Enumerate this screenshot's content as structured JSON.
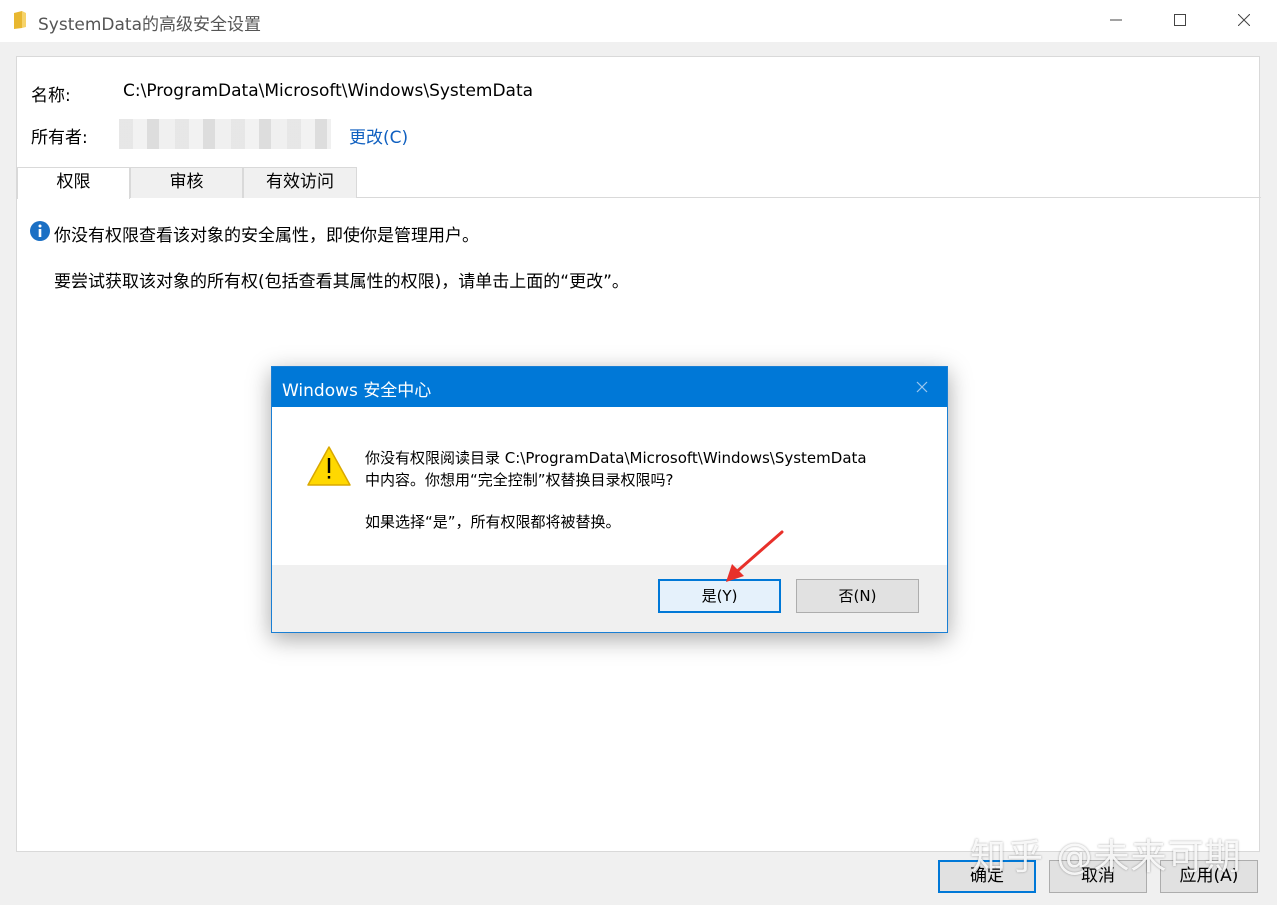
{
  "window": {
    "title": "SystemData的高级安全设置"
  },
  "panel": {
    "name_label": "名称:",
    "name_value": "C:\\ProgramData\\Microsoft\\Windows\\SystemData",
    "owner_label": "所有者:",
    "change_link": "更改(C)",
    "tabs": [
      {
        "label": "权限"
      },
      {
        "label": "审核"
      },
      {
        "label": "有效访问"
      }
    ],
    "info_text": "你没有权限查看该对象的安全属性，即使你是管理用户。",
    "hint_text": "要尝试获取该对象的所有权(包括查看其属性的权限)，请单击上面的“更改”。"
  },
  "buttons": {
    "ok": "确定",
    "cancel": "取消",
    "apply": "应用(A)"
  },
  "watermark": "知乎 @未来可期",
  "dialog": {
    "title": "Windows 安全中心",
    "line1": "你没有权限阅读目录 C:\\ProgramData\\Microsoft\\Windows\\SystemData",
    "line2": "中内容。你想用“完全控制”权替换目录权限吗?",
    "line3": "如果选择“是”，所有权限都将被替换。",
    "yes": "是(Y)",
    "no": "否(N)"
  },
  "colors": {
    "accent": "#0078d7",
    "link": "#1060c0",
    "warning": "#ffd800",
    "arrow": "#e8302a"
  }
}
